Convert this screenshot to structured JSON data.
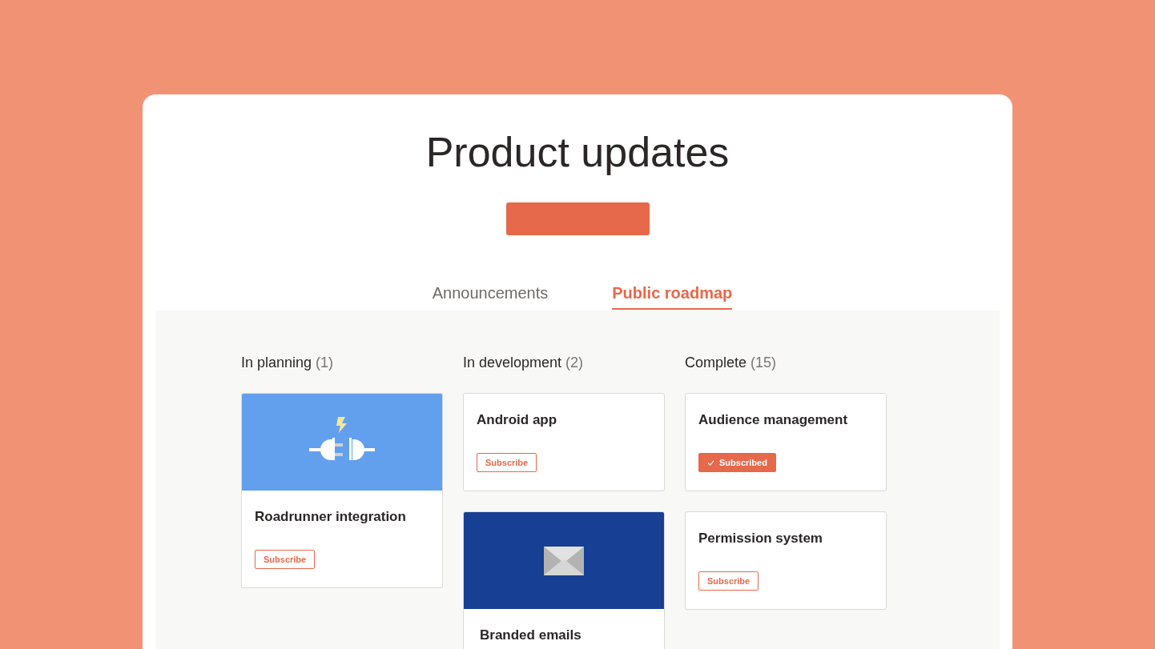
{
  "page": {
    "title": "Product updates"
  },
  "tabs": [
    {
      "label": "Announcements",
      "selected": false
    },
    {
      "label": "Public roadmap",
      "selected": true
    }
  ],
  "columns": [
    {
      "title": "In planning",
      "count": "(1)",
      "cards": [
        {
          "kind": "plugs",
          "title": "Roadrunner integration",
          "button": "Subscribe",
          "subscribed": false
        }
      ]
    },
    {
      "title": "In development",
      "count": "(2)",
      "cards": [
        {
          "kind": "text",
          "title": "Android app",
          "button": "Subscribe",
          "subscribed": false
        },
        {
          "kind": "envelope",
          "title": "Branded emails"
        }
      ]
    },
    {
      "title": "Complete",
      "count": "(15)",
      "cards": [
        {
          "kind": "text",
          "title": "Audience management",
          "button": "Subscribed",
          "subscribed": true
        },
        {
          "kind": "text",
          "title": "Permission system",
          "button": "Subscribe",
          "subscribed": false
        }
      ]
    }
  ]
}
